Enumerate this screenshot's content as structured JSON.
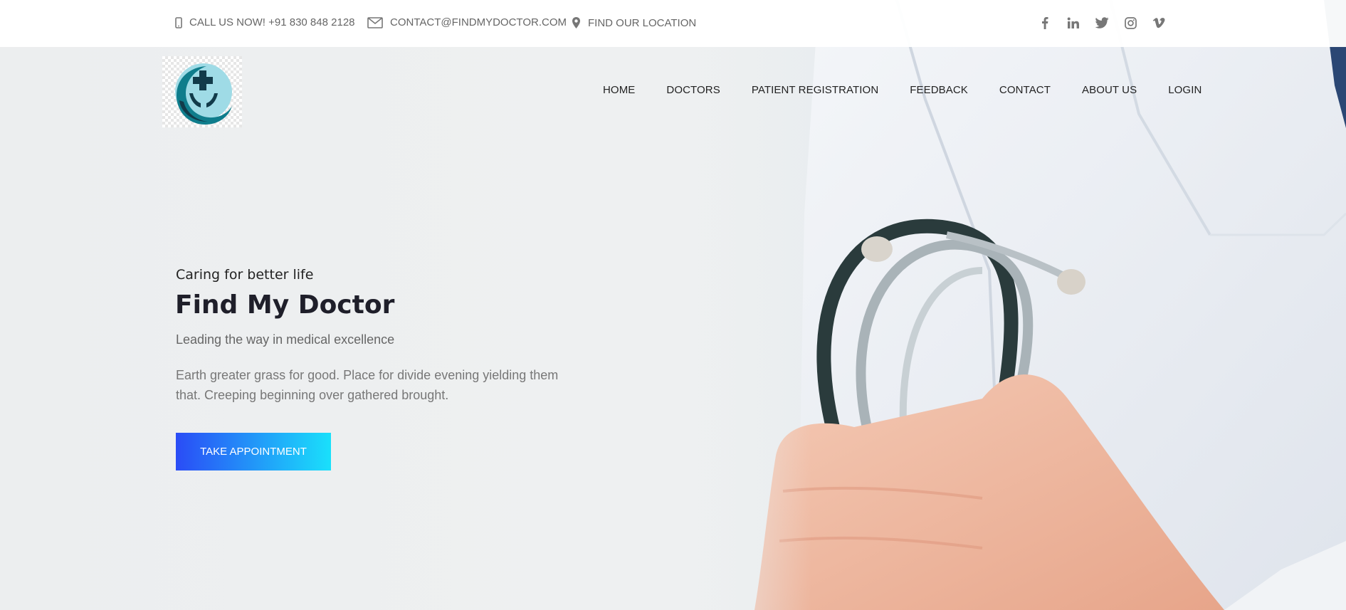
{
  "topbar": {
    "phone": "CALL US NOW! +91 830 848 2128",
    "email": "CONTACT@FINDMYDOCTOR.COM",
    "location": "FIND OUR LOCATION",
    "socials": [
      "facebook-icon",
      "linkedin-icon",
      "twitter-icon",
      "instagram-icon",
      "vimeo-icon"
    ]
  },
  "nav": {
    "items": [
      "HOME",
      "DOCTORS",
      "PATIENT REGISTRATION",
      "FEEDBACK",
      "CONTACT",
      "ABOUT US",
      "LOGIN"
    ]
  },
  "hero": {
    "tagline": "Caring for better life",
    "title": "Find My Doctor",
    "subtitle": "Leading the way in medical excellence",
    "description": "Earth greater grass for good. Place for divide evening yielding them that. Creeping beginning over gathered brought.",
    "cta_label": "TAKE APPOINTMENT"
  },
  "colors": {
    "cta_gradient_start": "#2a4cf6",
    "cta_gradient_end": "#1ae0fb",
    "logo_teal": "#0f7d8c",
    "logo_dark": "#123b4a"
  }
}
